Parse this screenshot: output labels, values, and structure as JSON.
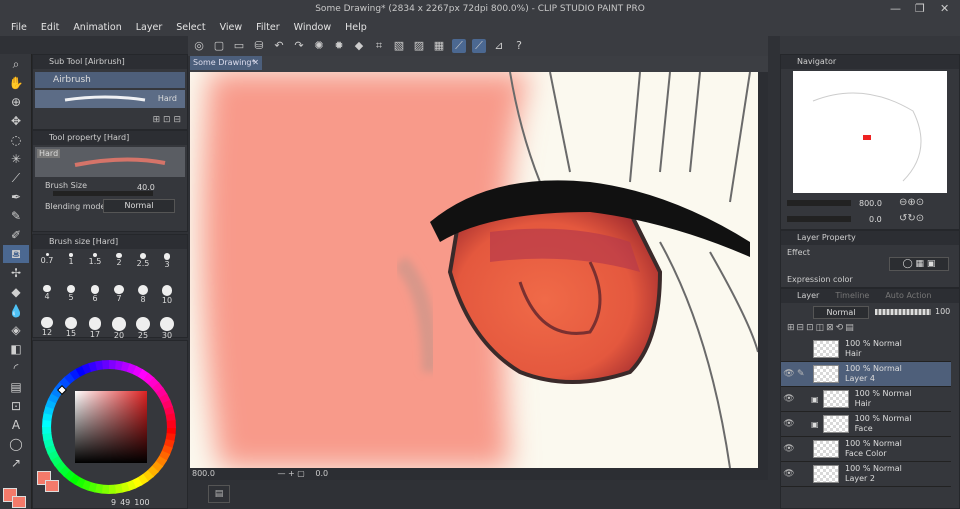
{
  "window": {
    "title": "Some Drawing* (2834 x 2267px 72dpi 800.0%)  -  CLIP STUDIO PAINT PRO",
    "min": "—",
    "max": "❐",
    "close": "✕"
  },
  "menu": [
    "File",
    "Edit",
    "Animation",
    "Layer",
    "Select",
    "View",
    "Filter",
    "Window",
    "Help"
  ],
  "subtool": {
    "header": "Sub Tool [Airbrush]",
    "selected": "Airbrush",
    "brush_name": "Hard"
  },
  "toolprop": {
    "header": "Tool property [Hard]",
    "brush_name": "Hard",
    "brush_size_label": "Brush Size",
    "brush_size_value": "40.0",
    "blending_label": "Blending mode",
    "blending_value": "Normal"
  },
  "brushsize": {
    "header": "Brush size [Hard]",
    "sizes": [
      "0.7",
      "1",
      "1.5",
      "2",
      "2.5",
      "3",
      "4",
      "5",
      "6",
      "7",
      "8",
      "10",
      "12",
      "15",
      "17",
      "20",
      "25",
      "30"
    ]
  },
  "color": {
    "main": "#f47a6a",
    "sub": "#f47a6a",
    "r": "9",
    "g": "49",
    "b": "100"
  },
  "canvas": {
    "tab": "Some Drawing*",
    "zoom": "800.0",
    "pos": "0.0"
  },
  "navigator": {
    "header": "Navigator",
    "zoom": "800.0",
    "angle": "0.0"
  },
  "layerprop": {
    "header": "Layer Property",
    "effect": "Effect",
    "expr": "Expression color"
  },
  "layerpanel": {
    "header": "Layer",
    "tab2": "Timeline",
    "tab3": "Auto Action",
    "blend": "Normal",
    "opacity": "100"
  },
  "layers": [
    {
      "mode": "100 % Normal",
      "name": "Hair",
      "selected": false,
      "eye": false,
      "clip": false
    },
    {
      "mode": "100 % Normal",
      "name": "Layer 4",
      "selected": true,
      "eye": true,
      "clip": false
    },
    {
      "mode": "100 % Normal",
      "name": "Hair",
      "selected": false,
      "eye": true,
      "clip": true
    },
    {
      "mode": "100 % Normal",
      "name": "Face",
      "selected": false,
      "eye": true,
      "clip": true
    },
    {
      "mode": "100 % Normal",
      "name": "Face Color",
      "selected": false,
      "eye": true,
      "clip": false
    },
    {
      "mode": "100 % Normal",
      "name": "Layer 2",
      "selected": false,
      "eye": true,
      "clip": false
    }
  ]
}
